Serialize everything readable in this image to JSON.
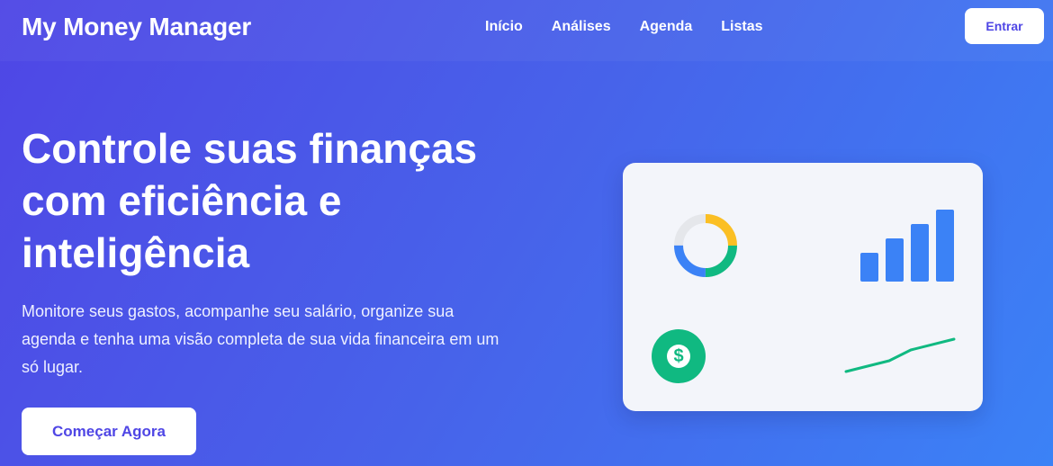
{
  "header": {
    "brand": "My Money Manager",
    "nav": [
      "Início",
      "Análises",
      "Agenda",
      "Listas"
    ],
    "login_label": "Entrar"
  },
  "hero": {
    "title": "Controle suas finanças com eficiência e inteligência",
    "subtitle": "Monitore seus gastos, acompanhe seu salário, organize sua agenda e tenha uma visão completa de sua vida financeira em um só lugar.",
    "cta_label": "Começar Agora"
  },
  "illustration": {
    "icons": [
      "donut-chart-icon",
      "bar-chart-icon",
      "dollar-icon",
      "trend-line-icon"
    ],
    "colors": {
      "primary": "#4f46e5",
      "blue": "#3b82f6",
      "green": "#10b981",
      "yellow": "#fbbf24",
      "gray": "#e5e7eb",
      "card": "#f3f5fa"
    }
  }
}
